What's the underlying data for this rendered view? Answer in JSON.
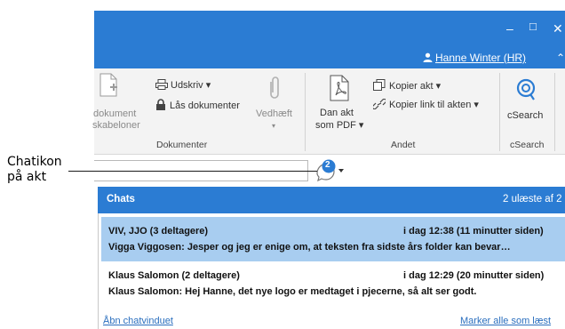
{
  "callout": {
    "line1": "Chatikon",
    "line2": "på akt"
  },
  "window": {
    "minimize": "‒",
    "maximize": "□",
    "close": "✕"
  },
  "user": {
    "name": "Hanne Winter (HR)"
  },
  "ribbon": {
    "partial_dokument": "dokument",
    "partial_skabeloner": "skabeloner",
    "udskriv": "Udskriv ▾",
    "laas": "Lås dokumenter",
    "vedhaeft": "Vedhæft",
    "vedhaeft_arrow": "▾",
    "dokumenter_group": "Dokumenter",
    "dan_akt_1": "Dan akt",
    "dan_akt_2": "som PDF ▾",
    "kopier_akt": "Kopier akt ▾",
    "kopier_link": "Kopier link til akten ▾",
    "andet_group": "Andet",
    "csearch": "cSearch",
    "csearch_group": "cSearch"
  },
  "chat_icon": {
    "badge": "2"
  },
  "chats": {
    "title": "Chats",
    "unread": "2 ulæste af 2",
    "items": [
      {
        "participants": "VIV, JJO (3 deltagere)",
        "time": "i dag 12:38 (11 minutter siden)",
        "message": "Vigga Viggosen: Jesper og jeg er enige om, at teksten fra sidste års folder kan bevar…"
      },
      {
        "participants": "Klaus Salomon (2 deltagere)",
        "time": "i dag 12:29 (20 minutter siden)",
        "message": "Klaus Salomon: Hej Hanne, det nye logo er medtaget i pjecerne, så alt ser godt."
      }
    ],
    "open_link": "Åbn chatvinduet",
    "mark_read": "Marker alle som læst"
  },
  "colors": {
    "accent": "#2b7cd3",
    "selected_row": "#a8cdf0",
    "link": "#2b6fbe"
  }
}
